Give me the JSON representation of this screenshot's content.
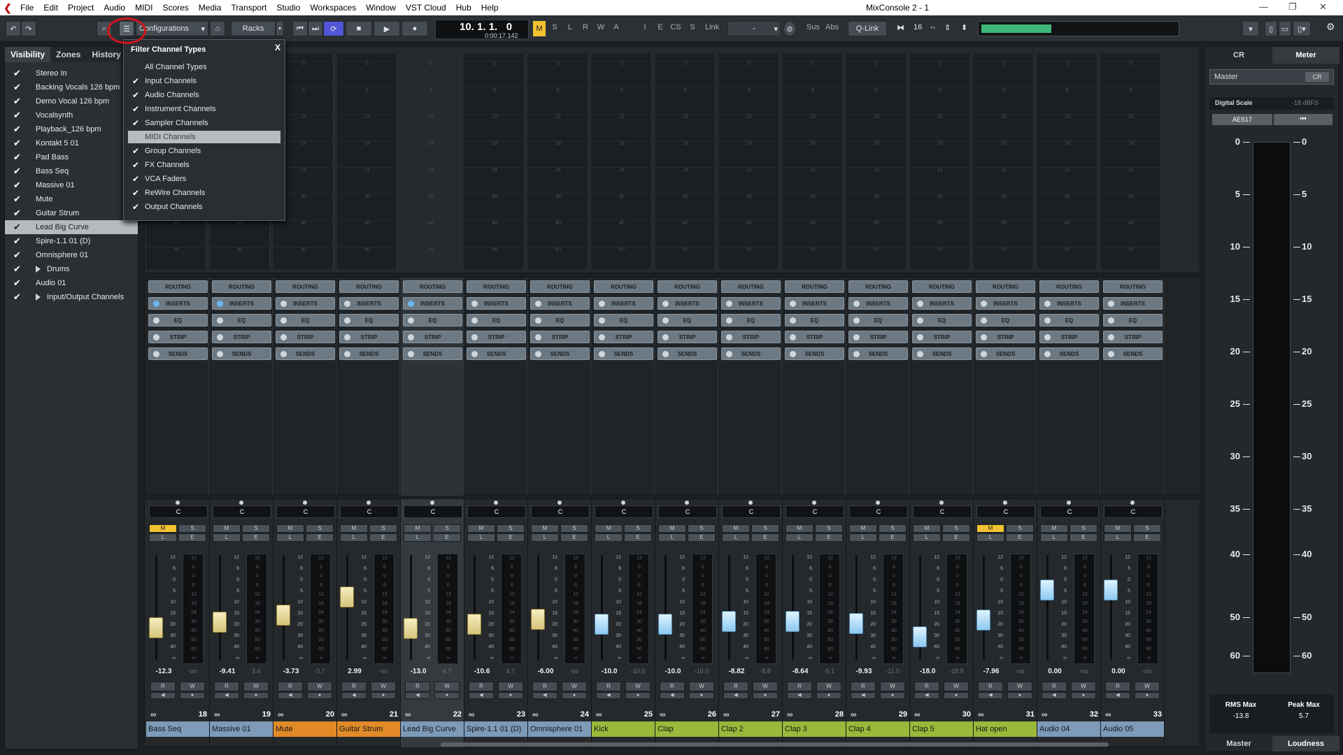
{
  "menubar": {
    "items": [
      "File",
      "Edit",
      "Project",
      "Audio",
      "MIDI",
      "Scores",
      "Media",
      "Transport",
      "Studio",
      "Workspaces",
      "Window",
      "VST Cloud",
      "Hub",
      "Help"
    ],
    "window_title": "MixConsole 2 - 1"
  },
  "toolbar": {
    "configurations_label": "Configurations",
    "racks_label": "Racks",
    "time_primary": "10. 1. 1.   0",
    "time_secondary": "0:00:17.142",
    "state_buttons": [
      "M",
      "S",
      "L",
      "R",
      "W",
      "A"
    ],
    "ie_buttons": [
      "I",
      "E",
      "CS",
      "S"
    ],
    "link_label": "Link",
    "link_value": "-",
    "sus_label": "Sus",
    "abs_label": "Abs",
    "qlink_label": "Q-Link",
    "zoom_value": "16"
  },
  "sidebar": {
    "tabs": [
      "Visibility",
      "Zones",
      "History"
    ],
    "items": [
      {
        "label": "Stereo In",
        "checked": true
      },
      {
        "label": "Backing Vocals 126 bpm",
        "checked": true
      },
      {
        "label": "Demo Vocal 126 bpm",
        "checked": true
      },
      {
        "label": "Vocalsynth",
        "checked": true
      },
      {
        "label": "Playback_126 bpm",
        "checked": true
      },
      {
        "label": "Kontakt 5 01",
        "checked": true
      },
      {
        "label": "Pad Bass",
        "checked": true
      },
      {
        "label": "Bass Seq",
        "checked": true
      },
      {
        "label": "Massive 01",
        "checked": true
      },
      {
        "label": "Mute",
        "checked": true
      },
      {
        "label": "Guitar Strum",
        "checked": true
      },
      {
        "label": "Lead Big Curve",
        "checked": true,
        "selected": true
      },
      {
        "label": "Spire-1.1 01 (D)",
        "checked": true
      },
      {
        "label": "Omnisphere 01",
        "checked": true
      },
      {
        "label": "Drums",
        "checked": true,
        "folder": true
      },
      {
        "label": "Audio 01",
        "checked": true
      },
      {
        "label": "Input/Output Channels",
        "checked": true,
        "folder": true
      }
    ]
  },
  "filter_popup": {
    "title": "Filter Channel Types",
    "close": "X",
    "items": [
      {
        "label": "All Channel Types",
        "checked": false
      },
      {
        "label": "Input Channels",
        "checked": true
      },
      {
        "label": "Audio Channels",
        "checked": true
      },
      {
        "label": "Instrument Channels",
        "checked": true
      },
      {
        "label": "Sampler Channels",
        "checked": true
      },
      {
        "label": "MIDI Channels",
        "checked": false,
        "highlight": true
      },
      {
        "label": "Group Channels",
        "checked": true
      },
      {
        "label": "FX Channels",
        "checked": true
      },
      {
        "label": "VCA Faders",
        "checked": true
      },
      {
        "label": "ReWire Channels",
        "checked": true
      },
      {
        "label": "Output Channels",
        "checked": true
      }
    ]
  },
  "upper_scale": [
    "0",
    "6",
    "12",
    "18",
    "24",
    "30",
    "40",
    "50"
  ],
  "rack_rows": [
    "ROUTING",
    "INSERTS",
    "EQ",
    "STRIP",
    "SENDS"
  ],
  "fader_scale": [
    "12",
    "6",
    "0",
    "5",
    "10",
    "15",
    "20",
    "30",
    "40",
    "∞"
  ],
  "meter_scale": [
    "12",
    "6",
    "0",
    "6",
    "12",
    "18",
    "24",
    "30",
    "40",
    "50",
    "60",
    "∞"
  ],
  "pan_label": "C",
  "channels": [
    {
      "num": "18",
      "name": "Bass Seq",
      "vol": "-12.3",
      "peak": "-oo",
      "color": "#7d9ab8",
      "fader": 0.69,
      "cap": "y",
      "mute": true,
      "inserts_on": true
    },
    {
      "num": "19",
      "name": "Massive 01",
      "vol": "-9.41",
      "peak": "3.4",
      "color": "#7d9ab8",
      "fader": 0.64,
      "cap": "y",
      "mute": false,
      "inserts_on": true
    },
    {
      "num": "20",
      "name": "Mute",
      "vol": "-3.73",
      "peak": "-3.7",
      "color": "#e08a28",
      "fader": 0.57,
      "cap": "y",
      "mute": false,
      "inserts_on": false
    },
    {
      "num": "21",
      "name": "Guitar Strum",
      "vol": "2.99",
      "peak": "-oo",
      "color": "#e08a28",
      "fader": 0.4,
      "cap": "y",
      "mute": false,
      "inserts_on": false
    },
    {
      "num": "22",
      "name": "Lead Big Curve",
      "vol": "-13.0",
      "peak": "4.7",
      "color": "#7d9ab8",
      "fader": 0.7,
      "cap": "y",
      "mute": false,
      "inserts_on": true,
      "selected": true
    },
    {
      "num": "23",
      "name": "Spire-1.1 01 (D)",
      "vol": "-10.6",
      "peak": "4.7",
      "color": "#7d9ab8",
      "fader": 0.66,
      "cap": "y",
      "mute": false,
      "inserts_on": false
    },
    {
      "num": "24",
      "name": "Omnisphere 01",
      "vol": "-6.00",
      "peak": "-oo",
      "color": "#7d9ab8",
      "fader": 0.61,
      "cap": "y",
      "mute": false,
      "inserts_on": false
    },
    {
      "num": "25",
      "name": "Kick",
      "vol": "-10.0",
      "peak": "-10.0",
      "color": "#9ab83a",
      "fader": 0.66,
      "cap": "b",
      "mute": false,
      "inserts_on": false
    },
    {
      "num": "26",
      "name": "Clap",
      "vol": "-10.0",
      "peak": "-10.0",
      "color": "#9ab83a",
      "fader": 0.66,
      "cap": "b",
      "mute": false,
      "inserts_on": false
    },
    {
      "num": "27",
      "name": "Clap 2",
      "vol": "-8.82",
      "peak": "-8.8",
      "color": "#9ab83a",
      "fader": 0.63,
      "cap": "b",
      "mute": false,
      "inserts_on": false
    },
    {
      "num": "28",
      "name": "Clap 3",
      "vol": "-8.64",
      "peak": "-9.1",
      "color": "#9ab83a",
      "fader": 0.63,
      "cap": "b",
      "mute": false,
      "inserts_on": false
    },
    {
      "num": "29",
      "name": "Clap 4",
      "vol": "-9.93",
      "peak": "-11.0",
      "color": "#9ab83a",
      "fader": 0.65,
      "cap": "b",
      "mute": false,
      "inserts_on": false
    },
    {
      "num": "30",
      "name": "Clap 5",
      "vol": "-18.0",
      "peak": "-18.9",
      "color": "#9ab83a",
      "fader": 0.78,
      "cap": "b",
      "mute": false,
      "inserts_on": false
    },
    {
      "num": "31",
      "name": "Hat open",
      "vol": "-7.96",
      "peak": "-oo",
      "color": "#9ab83a",
      "fader": 0.62,
      "cap": "b",
      "mute": true,
      "inserts_on": false
    },
    {
      "num": "32",
      "name": "Audio 04",
      "vol": "0.00",
      "peak": "-oo",
      "color": "#7d9ab8",
      "fader": 0.33,
      "cap": "b",
      "mute": false,
      "inserts_on": false
    },
    {
      "num": "33",
      "name": "Audio 05",
      "vol": "0.00",
      "peak": "-oo",
      "color": "#7d9ab8",
      "fader": 0.33,
      "cap": "b",
      "mute": false,
      "inserts_on": false
    }
  ],
  "right_panel": {
    "tabs": [
      "CR",
      "Meter"
    ],
    "master_label": "Master",
    "cr_button": "CR",
    "digital_scale_label": "Digital Scale",
    "digital_scale_value": "-18 dBFS",
    "aes_label": "AES17",
    "scale": [
      "0",
      "5",
      "10",
      "15",
      "20",
      "25",
      "30",
      "35",
      "40",
      "50",
      "60"
    ],
    "rms_max_label": "RMS Max",
    "rms_max_value": "-13.8",
    "peak_max_label": "Peak Max",
    "peak_max_value": "5.7",
    "bottom_tabs": [
      "Master",
      "Loudness"
    ]
  },
  "colors": {
    "mute_on": "#f2c230",
    "accent_blue": "#6bb8ef",
    "meter_green": "#3fb67a"
  }
}
